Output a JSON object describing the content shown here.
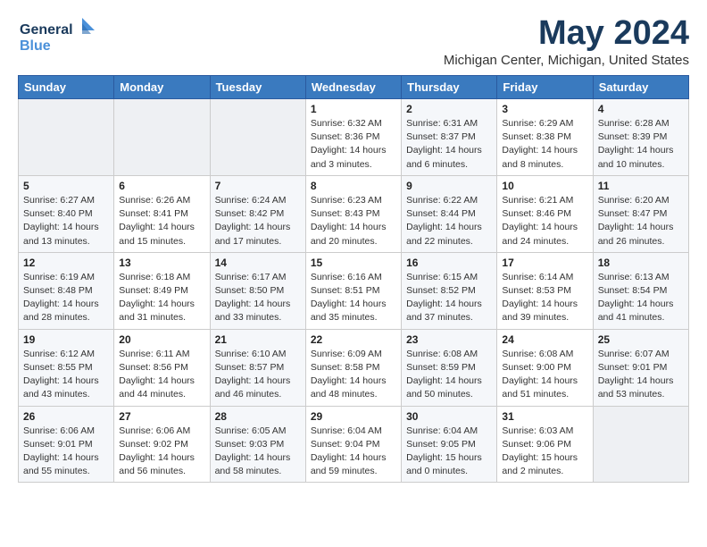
{
  "header": {
    "logo_general": "General",
    "logo_blue": "Blue",
    "title": "May 2024",
    "location": "Michigan Center, Michigan, United States"
  },
  "days_of_week": [
    "Sunday",
    "Monday",
    "Tuesday",
    "Wednesday",
    "Thursday",
    "Friday",
    "Saturday"
  ],
  "weeks": [
    {
      "days": [
        {
          "num": "",
          "info": ""
        },
        {
          "num": "",
          "info": ""
        },
        {
          "num": "",
          "info": ""
        },
        {
          "num": "1",
          "info": "Sunrise: 6:32 AM\nSunset: 8:36 PM\nDaylight: 14 hours and 3 minutes."
        },
        {
          "num": "2",
          "info": "Sunrise: 6:31 AM\nSunset: 8:37 PM\nDaylight: 14 hours and 6 minutes."
        },
        {
          "num": "3",
          "info": "Sunrise: 6:29 AM\nSunset: 8:38 PM\nDaylight: 14 hours and 8 minutes."
        },
        {
          "num": "4",
          "info": "Sunrise: 6:28 AM\nSunset: 8:39 PM\nDaylight: 14 hours and 10 minutes."
        }
      ]
    },
    {
      "days": [
        {
          "num": "5",
          "info": "Sunrise: 6:27 AM\nSunset: 8:40 PM\nDaylight: 14 hours and 13 minutes."
        },
        {
          "num": "6",
          "info": "Sunrise: 6:26 AM\nSunset: 8:41 PM\nDaylight: 14 hours and 15 minutes."
        },
        {
          "num": "7",
          "info": "Sunrise: 6:24 AM\nSunset: 8:42 PM\nDaylight: 14 hours and 17 minutes."
        },
        {
          "num": "8",
          "info": "Sunrise: 6:23 AM\nSunset: 8:43 PM\nDaylight: 14 hours and 20 minutes."
        },
        {
          "num": "9",
          "info": "Sunrise: 6:22 AM\nSunset: 8:44 PM\nDaylight: 14 hours and 22 minutes."
        },
        {
          "num": "10",
          "info": "Sunrise: 6:21 AM\nSunset: 8:46 PM\nDaylight: 14 hours and 24 minutes."
        },
        {
          "num": "11",
          "info": "Sunrise: 6:20 AM\nSunset: 8:47 PM\nDaylight: 14 hours and 26 minutes."
        }
      ]
    },
    {
      "days": [
        {
          "num": "12",
          "info": "Sunrise: 6:19 AM\nSunset: 8:48 PM\nDaylight: 14 hours and 28 minutes."
        },
        {
          "num": "13",
          "info": "Sunrise: 6:18 AM\nSunset: 8:49 PM\nDaylight: 14 hours and 31 minutes."
        },
        {
          "num": "14",
          "info": "Sunrise: 6:17 AM\nSunset: 8:50 PM\nDaylight: 14 hours and 33 minutes."
        },
        {
          "num": "15",
          "info": "Sunrise: 6:16 AM\nSunset: 8:51 PM\nDaylight: 14 hours and 35 minutes."
        },
        {
          "num": "16",
          "info": "Sunrise: 6:15 AM\nSunset: 8:52 PM\nDaylight: 14 hours and 37 minutes."
        },
        {
          "num": "17",
          "info": "Sunrise: 6:14 AM\nSunset: 8:53 PM\nDaylight: 14 hours and 39 minutes."
        },
        {
          "num": "18",
          "info": "Sunrise: 6:13 AM\nSunset: 8:54 PM\nDaylight: 14 hours and 41 minutes."
        }
      ]
    },
    {
      "days": [
        {
          "num": "19",
          "info": "Sunrise: 6:12 AM\nSunset: 8:55 PM\nDaylight: 14 hours and 43 minutes."
        },
        {
          "num": "20",
          "info": "Sunrise: 6:11 AM\nSunset: 8:56 PM\nDaylight: 14 hours and 44 minutes."
        },
        {
          "num": "21",
          "info": "Sunrise: 6:10 AM\nSunset: 8:57 PM\nDaylight: 14 hours and 46 minutes."
        },
        {
          "num": "22",
          "info": "Sunrise: 6:09 AM\nSunset: 8:58 PM\nDaylight: 14 hours and 48 minutes."
        },
        {
          "num": "23",
          "info": "Sunrise: 6:08 AM\nSunset: 8:59 PM\nDaylight: 14 hours and 50 minutes."
        },
        {
          "num": "24",
          "info": "Sunrise: 6:08 AM\nSunset: 9:00 PM\nDaylight: 14 hours and 51 minutes."
        },
        {
          "num": "25",
          "info": "Sunrise: 6:07 AM\nSunset: 9:01 PM\nDaylight: 14 hours and 53 minutes."
        }
      ]
    },
    {
      "days": [
        {
          "num": "26",
          "info": "Sunrise: 6:06 AM\nSunset: 9:01 PM\nDaylight: 14 hours and 55 minutes."
        },
        {
          "num": "27",
          "info": "Sunrise: 6:06 AM\nSunset: 9:02 PM\nDaylight: 14 hours and 56 minutes."
        },
        {
          "num": "28",
          "info": "Sunrise: 6:05 AM\nSunset: 9:03 PM\nDaylight: 14 hours and 58 minutes."
        },
        {
          "num": "29",
          "info": "Sunrise: 6:04 AM\nSunset: 9:04 PM\nDaylight: 14 hours and 59 minutes."
        },
        {
          "num": "30",
          "info": "Sunrise: 6:04 AM\nSunset: 9:05 PM\nDaylight: 15 hours and 0 minutes."
        },
        {
          "num": "31",
          "info": "Sunrise: 6:03 AM\nSunset: 9:06 PM\nDaylight: 15 hours and 2 minutes."
        },
        {
          "num": "",
          "info": ""
        }
      ]
    }
  ]
}
